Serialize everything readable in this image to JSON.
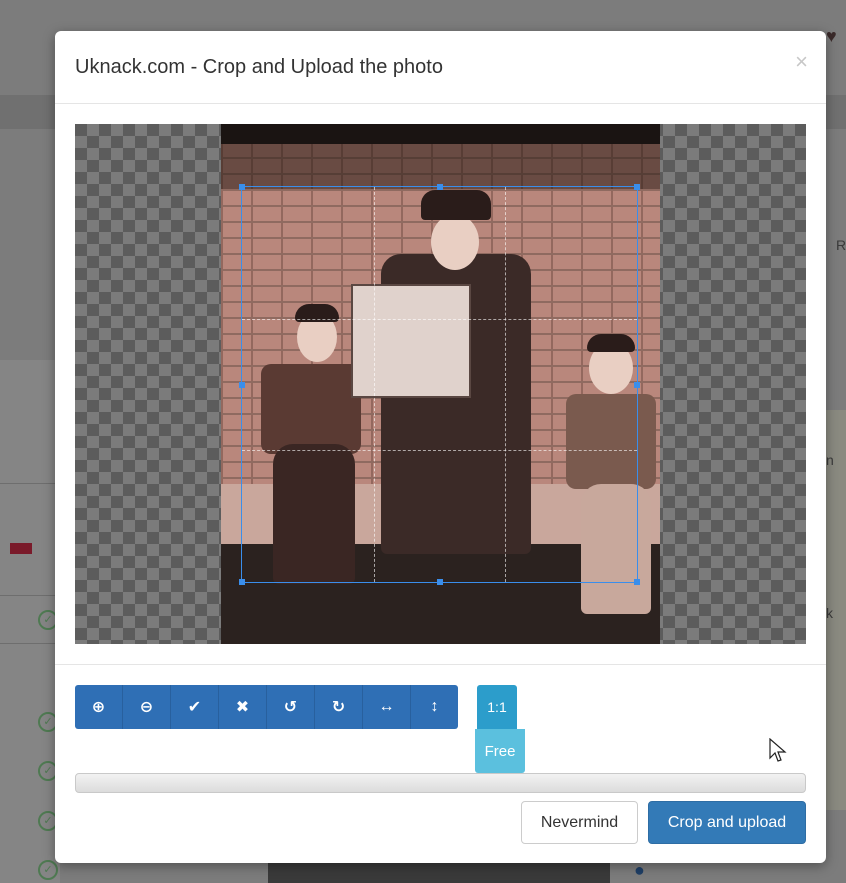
{
  "modal": {
    "title": "Uknack.com - Crop and Upload the photo",
    "close_label": "×"
  },
  "toolbar": {
    "buttons": [
      {
        "name": "zoom-in",
        "icon": "⊕"
      },
      {
        "name": "zoom-out",
        "icon": "⊖"
      },
      {
        "name": "apply",
        "icon": "✔"
      },
      {
        "name": "clear",
        "icon": "✖"
      },
      {
        "name": "rotate-left",
        "icon": "↺"
      },
      {
        "name": "rotate-right",
        "icon": "↻"
      },
      {
        "name": "flip-horizontal",
        "icon": "↔"
      },
      {
        "name": "flip-vertical",
        "icon": "↕"
      }
    ]
  },
  "aspect": {
    "one_to_one": "1:1",
    "free": "Free"
  },
  "actions": {
    "nevermind": "Nevermind",
    "crop_upload": "Crop and upload"
  },
  "background": {
    "right_letter_1": "R",
    "right_letter_2": "n",
    "right_letter_3": "k"
  },
  "colors": {
    "primary": "#337ab7",
    "toolbar": "#2f6fb5",
    "ratio_active": "#2c9dcb",
    "ratio_free": "#5bc0de",
    "crop_border": "#3a8eeb"
  }
}
